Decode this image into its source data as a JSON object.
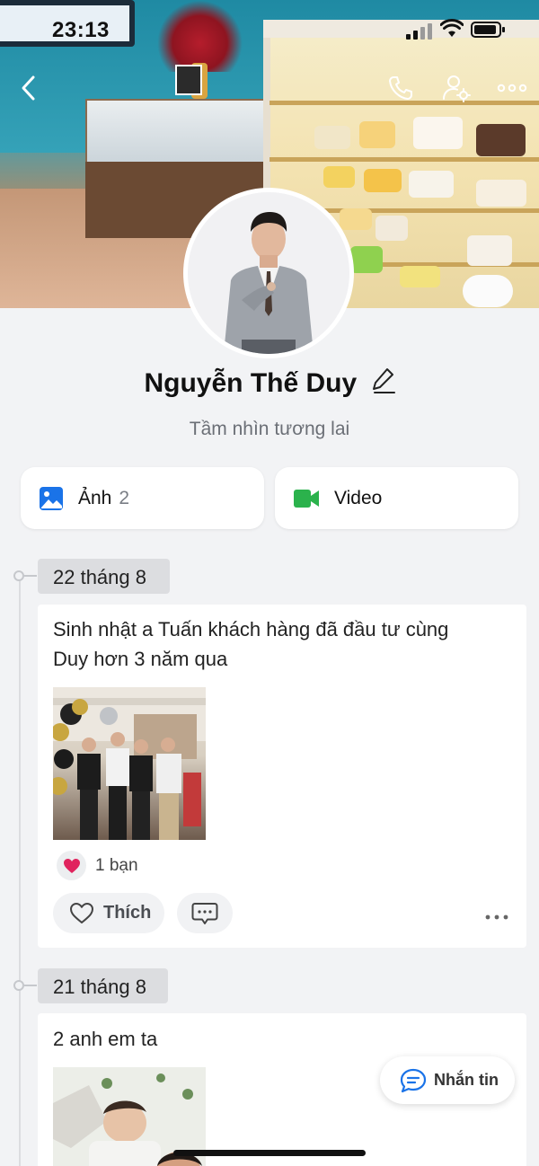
{
  "status_bar": {
    "time": "23:13"
  },
  "profile": {
    "name": "Nguyễn Thế Duy",
    "bio": "Tầm nhìn tương lai"
  },
  "media_tiles": {
    "photos": {
      "label": "Ảnh",
      "count": "2",
      "icon": "image-icon",
      "color": "#1a73e8"
    },
    "video": {
      "label": "Video",
      "icon": "video-camera-icon",
      "color": "#2bb24c"
    }
  },
  "timeline": {
    "posts": [
      {
        "date": "22 tháng 8",
        "text_line1": "Sinh nhật a Tuấn khách hàng đã đầu tư cùng",
        "text_line2": "Duy hơn 3 năm qua",
        "reactions": "1 bạn",
        "like_label": "Thích"
      },
      {
        "date": "21 tháng 8",
        "text_line1": "2 anh em ta"
      }
    ]
  },
  "message_button": {
    "label": "Nhắn tin"
  },
  "colors": {
    "accent": "#1a73e8",
    "background": "#f2f3f5",
    "heart": "#e0245e"
  }
}
